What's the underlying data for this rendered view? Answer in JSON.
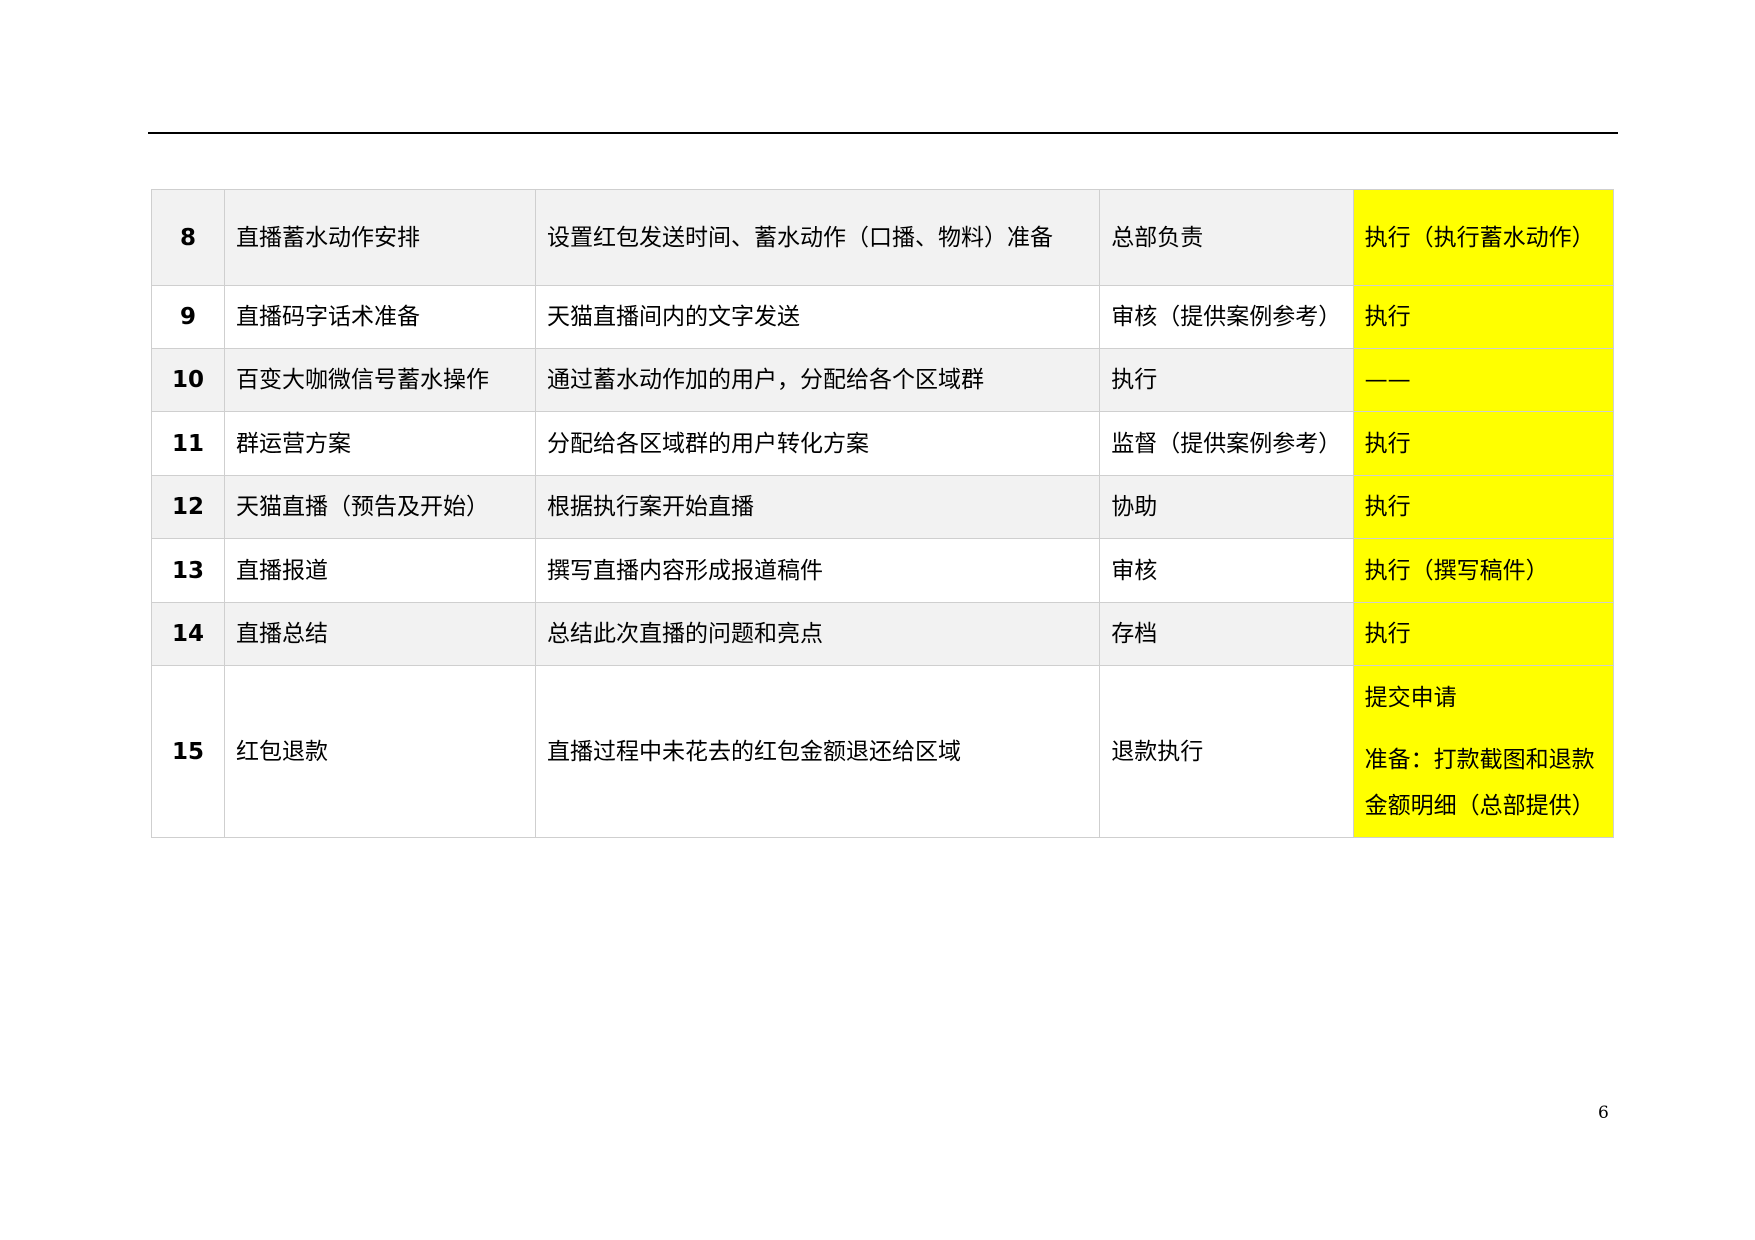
{
  "table": {
    "rows": [
      {
        "num": "8",
        "item": "直播蓄水动作安排",
        "desc": "设置红包发送时间、蓄水动作（口播、物料）准备",
        "hq": "总部负责",
        "branch": [
          "执行（执行蓄水动作）"
        ]
      },
      {
        "num": "9",
        "item": "直播码字话术准备",
        "desc": "天猫直播间内的文字发送",
        "hq": "审核（提供案例参考）",
        "branch": [
          "执行"
        ]
      },
      {
        "num": "10",
        "item": "百变大咖微信号蓄水操作",
        "desc": "通过蓄水动作加的用户，分配给各个区域群",
        "hq": "执行",
        "branch": [
          "——"
        ]
      },
      {
        "num": "11",
        "item": "群运营方案",
        "desc": "分配给各区域群的用户转化方案",
        "hq": "监督（提供案例参考）",
        "branch": [
          "执行"
        ]
      },
      {
        "num": "12",
        "item": "天猫直播（预告及开始）",
        "desc": "根据执行案开始直播",
        "hq": "协助",
        "branch": [
          "执行"
        ]
      },
      {
        "num": "13",
        "item": "直播报道",
        "desc": "撰写直播内容形成报道稿件",
        "hq": "审核",
        "branch": [
          "执行（撰写稿件）"
        ]
      },
      {
        "num": "14",
        "item": "直播总结",
        "desc": "总结此次直播的问题和亮点",
        "hq": "存档",
        "branch": [
          "执行"
        ]
      },
      {
        "num": "15",
        "item": "红包退款",
        "desc": "直播过程中未花去的红包金额退还给区域",
        "hq": "退款执行",
        "branch": [
          "提交申请",
          "准备：打款截图和退款金额明细（总部提供）"
        ]
      }
    ]
  },
  "page_number": "6",
  "colors": {
    "highlight": "#ffff00",
    "row_gray": "#f2f2f2",
    "border": "#cfcfcf"
  }
}
